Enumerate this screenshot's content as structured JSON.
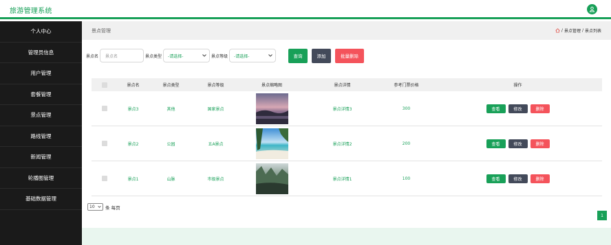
{
  "app": {
    "title": "旅游管理系统"
  },
  "sidebar": {
    "items": [
      {
        "label": "个人中心"
      },
      {
        "label": "管理员信息"
      },
      {
        "label": "用户管理"
      },
      {
        "label": "套餐管理"
      },
      {
        "label": "景点管理"
      },
      {
        "label": "路线管理"
      },
      {
        "label": "新闻管理"
      },
      {
        "label": "轮播图管理"
      },
      {
        "label": "基础数据管理"
      }
    ]
  },
  "breadcrumb": {
    "title": "景点管理",
    "sep": "/",
    "level1": "景点管理",
    "level2": "景点列表"
  },
  "filters": {
    "name_label": "景点名",
    "name_placeholder": "景点名",
    "type_label": "景点类型",
    "type_value": "-请选择-",
    "level_label": "景点等级",
    "level_value": "-请选择-"
  },
  "buttons": {
    "query": "查询",
    "add": "添加",
    "batch_delete": "批量删除"
  },
  "table": {
    "headers": [
      "景点名",
      "景点类型",
      "景点等级",
      "景点缩略图",
      "景点详情",
      "参考门票价格",
      "操作"
    ],
    "rows": [
      {
        "name": "景点3",
        "type": "其他",
        "level": "国家景点",
        "detail": "景点详情3",
        "price": "300",
        "view": "查看",
        "edit": "修改",
        "delete": "删除"
      },
      {
        "name": "景点2",
        "type": "公园",
        "level": "五A景点",
        "detail": "景点详情2",
        "price": "200",
        "view": "查看",
        "edit": "修改",
        "delete": "删除"
      },
      {
        "name": "景点1",
        "type": "山脉",
        "level": "市级景点",
        "detail": "景点详情1",
        "price": "100",
        "view": "查看",
        "edit": "修改",
        "delete": "删除"
      }
    ]
  },
  "pagination": {
    "page_size": "10",
    "per_page_label": "条 每页",
    "current_page": "1"
  },
  "colors": {
    "primary": "#18a058",
    "dark": "#434a5a",
    "danger": "#f4535b",
    "sidebar": "#1a1a1a"
  },
  "icons": {
    "user": "user-icon",
    "home": "home-icon"
  }
}
